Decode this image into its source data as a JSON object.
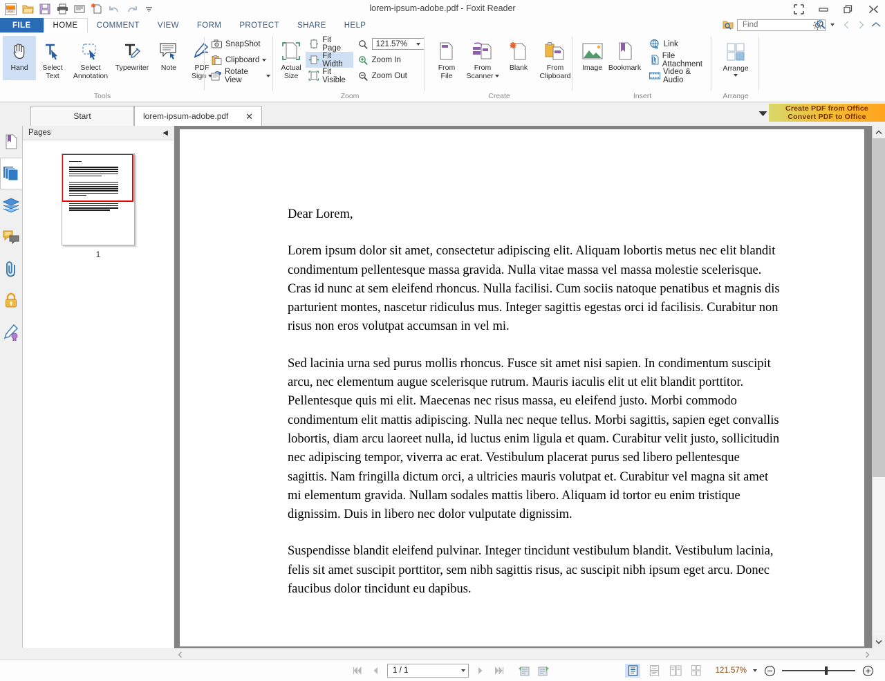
{
  "window": {
    "title": "lorem-ipsum-adobe.pdf - Foxit Reader",
    "quick_access": [
      {
        "name": "foxit-logo-icon",
        "label": "Foxit"
      },
      {
        "name": "open-icon",
        "label": "Open"
      },
      {
        "name": "save-icon",
        "label": "Save"
      },
      {
        "name": "print-icon",
        "label": "Print"
      },
      {
        "name": "email-icon",
        "label": "Email"
      },
      {
        "name": "new-document-icon",
        "label": "New"
      },
      {
        "name": "undo-icon",
        "label": "Undo"
      },
      {
        "name": "redo-icon",
        "label": "Redo"
      },
      {
        "name": "customize-qat-icon",
        "label": "Customize Quick Access Toolbar"
      }
    ],
    "controls": [
      {
        "name": "restore-layout-icon",
        "label": "Toggle Full Screen"
      },
      {
        "name": "minimize-icon",
        "label": "Minimize"
      },
      {
        "name": "restore-icon",
        "label": "Restore"
      },
      {
        "name": "close-icon",
        "label": "Close"
      }
    ]
  },
  "ribbon": {
    "tabs": [
      {
        "label": "FILE",
        "active": false,
        "file": true
      },
      {
        "label": "HOME",
        "active": true
      },
      {
        "label": "COMMENT",
        "active": false
      },
      {
        "label": "VIEW",
        "active": false
      },
      {
        "label": "FORM",
        "active": false
      },
      {
        "label": "PROTECT",
        "active": false
      },
      {
        "label": "SHARE",
        "active": false
      },
      {
        "label": "HELP",
        "active": false
      }
    ],
    "find": {
      "placeholder": "Find",
      "value": ""
    },
    "groups": {
      "tools": {
        "label": "Tools",
        "buttons": [
          {
            "label1": "Hand",
            "label2": "",
            "icon": "hand-icon",
            "selected": true
          },
          {
            "label1": "Select",
            "label2": "Text",
            "icon": "select-text-icon",
            "selected": false
          },
          {
            "label1": "Select",
            "label2": "Annotation",
            "icon": "select-annotation-icon",
            "selected": false
          },
          {
            "label1": "Typewriter",
            "label2": "",
            "icon": "typewriter-icon",
            "selected": false
          },
          {
            "label1": "Note",
            "label2": "",
            "icon": "note-icon",
            "selected": false
          },
          {
            "label1": "PDF",
            "label2": "Sign",
            "icon": "pdf-sign-icon",
            "selected": false,
            "dropdown": true
          }
        ]
      },
      "view_small": {
        "items": [
          {
            "label": "SnapShot",
            "icon": "snapshot-icon",
            "dropdown": false
          },
          {
            "label": "Clipboard",
            "icon": "clipboard-icon",
            "dropdown": true
          },
          {
            "label": "Rotate View",
            "icon": "rotate-view-icon",
            "dropdown": true
          }
        ]
      },
      "zoom": {
        "label": "Zoom",
        "actual_size": {
          "label1": "Actual",
          "label2": "Size",
          "icon": "actual-size-icon"
        },
        "items": [
          {
            "label": "Fit Page",
            "icon": "fit-page-icon",
            "selected": false
          },
          {
            "label": "Fit Width",
            "icon": "fit-width-icon",
            "selected": true
          },
          {
            "label": "Fit Visible",
            "icon": "fit-visible-icon",
            "selected": false
          }
        ],
        "zoom_value": "121.57%",
        "zoom_in": {
          "label": "Zoom In",
          "icon": "zoom-in-icon"
        },
        "zoom_out": {
          "label": "Zoom Out",
          "icon": "zoom-out-icon"
        }
      },
      "create": {
        "label": "Create",
        "buttons": [
          {
            "label1": "From",
            "label2": "File",
            "icon": "from-file-icon"
          },
          {
            "label1": "From",
            "label2": "Scanner",
            "icon": "from-scanner-icon",
            "dropdown": true
          },
          {
            "label1": "Blank",
            "label2": "",
            "icon": "blank-icon"
          },
          {
            "label1": "From",
            "label2": "Clipboard",
            "icon": "from-clipboard-icon"
          }
        ]
      },
      "insert": {
        "label": "Insert",
        "buttons": [
          {
            "label1": "Image",
            "label2": "",
            "icon": "image-icon"
          },
          {
            "label1": "Bookmark",
            "label2": "",
            "icon": "bookmark-icon"
          }
        ],
        "items": [
          {
            "label": "Link",
            "icon": "link-icon"
          },
          {
            "label": "File Attachment",
            "icon": "file-attachment-icon"
          },
          {
            "label": "Video & Audio",
            "icon": "video-audio-icon"
          }
        ]
      },
      "arrange": {
        "label": "Arrange",
        "button": {
          "label": "Arrange",
          "icon": "arrange-icon",
          "dropdown": true
        }
      }
    }
  },
  "doc_tabs": [
    {
      "label": "Start",
      "active": false,
      "closable": false
    },
    {
      "label": "lorem-ipsum-adobe.pdf",
      "active": true,
      "closable": true,
      "close_glyph": "✕"
    }
  ],
  "promo": {
    "line1": "Create PDF from Office",
    "line2": "Convert PDF to Office"
  },
  "rail": [
    {
      "name": "bookmarks-panel-icon",
      "selected": false
    },
    {
      "name": "pages-panel-icon",
      "selected": true
    },
    {
      "name": "layers-panel-icon",
      "selected": false
    },
    {
      "name": "comments-panel-icon",
      "selected": false
    },
    {
      "name": "attachments-panel-icon",
      "selected": false
    },
    {
      "name": "security-panel-icon",
      "selected": false
    },
    {
      "name": "digital-signature-panel-icon",
      "selected": false
    }
  ],
  "pages_panel": {
    "title": "Pages",
    "collapse_glyph": "◀",
    "thumbnails": [
      {
        "number": "1",
        "selected": true
      }
    ]
  },
  "document": {
    "paragraphs": [
      "Dear Lorem,",
      "Lorem ipsum dolor sit amet, consectetur adipiscing elit. Aliquam lobortis metus nec elit blandit condimentum pellentesque massa gravida. Nulla vitae massa vel massa molestie scelerisque. Cras id nunc at sem eleifend rhoncus. Nulla facilisi. Cum sociis natoque penatibus et magnis dis parturient montes, nascetur ridiculus mus. Integer sagittis egestas orci id facilisis. Curabitur non risus non eros volutpat accumsan in vel mi.",
      "Sed lacinia urna sed purus mollis rhoncus. Fusce sit amet nisi sapien. In condimentum suscipit arcu, nec elementum augue scelerisque rutrum. Mauris iaculis elit ut elit blandit porttitor. Pellentesque quis mi elit. Maecenas nec risus massa, eu eleifend justo. Morbi commodo condimentum elit mattis adipiscing. Nulla nec neque tellus. Morbi sagittis, sapien eget convallis lobortis, diam arcu laoreet nulla, id luctus enim ligula et quam. Curabitur velit justo, sollicitudin nec adipiscing tempor, viverra ac erat. Vestibulum placerat purus sed libero pellentesque sagittis. Nam fringilla dictum orci, a ultricies mauris volutpat et. Curabitur vel magna sit amet mi elementum gravida. Nullam sodales mattis libero. Aliquam id tortor eu enim tristique dignissim. Duis in libero nec dolor vulputate dignissim.",
      "Suspendisse blandit eleifend pulvinar. Integer tincidunt vestibulum blandit. Vestibulum lacinia, felis sit amet suscipit porttitor, sem nibh sagittis risus, ac suscipit nibh ipsum eget arcu. Donec faucibus dolor tincidunt eu dapibus."
    ]
  },
  "status": {
    "first_page": "first-page-icon",
    "prev_page": "previous-page-icon",
    "page_value": "1 / 1",
    "next_page": "next-page-icon",
    "last_page": "last-page-icon",
    "prev_view": "previous-view-icon",
    "next_view": "next-view-icon",
    "view_modes": [
      {
        "name": "single-page-view-icon",
        "selected": true
      },
      {
        "name": "continuous-view-icon",
        "selected": false
      },
      {
        "name": "facing-view-icon",
        "selected": false
      },
      {
        "name": "continuous-facing-view-icon",
        "selected": false
      }
    ],
    "zoom_value": "121.57%",
    "zoom_out": "zoom-out-icon",
    "zoom_in": "zoom-in-icon"
  },
  "colors": {
    "file_tab": "#2a6bb5",
    "selection": "#cfe0f5",
    "thumb_selection": "#ee0000",
    "zoom_text": "#8a4b12",
    "doc_background": "#828282"
  }
}
